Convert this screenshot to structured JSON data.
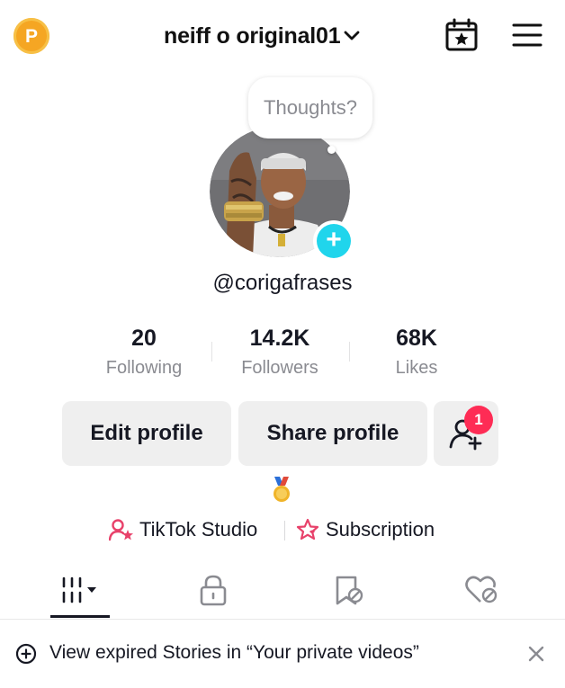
{
  "header": {
    "coin_letter": "P",
    "account_name": "neiff o original01"
  },
  "profile": {
    "thought_bubble": "Thoughts?",
    "add_button": "+",
    "username": "@corigafrases",
    "stats": [
      {
        "value": "20",
        "label": "Following"
      },
      {
        "value": "14.2K",
        "label": "Followers"
      },
      {
        "value": "68K",
        "label": "Likes"
      }
    ],
    "buttons": {
      "edit": "Edit profile",
      "share": "Share profile",
      "add_friend_badge": "1"
    },
    "links": {
      "studio": "TikTok Studio",
      "subscription": "Subscription"
    }
  },
  "tabs": [
    "videos-grid",
    "private",
    "reposts",
    "liked"
  ],
  "banner": {
    "text": "View expired Stories in “Your private videos”"
  },
  "colors": {
    "accent_cyan": "#20d5ec",
    "badge_red": "#fe2c55",
    "coin": "#f5a623",
    "button_bg": "#efefef",
    "pink_icon": "#e8416a"
  }
}
